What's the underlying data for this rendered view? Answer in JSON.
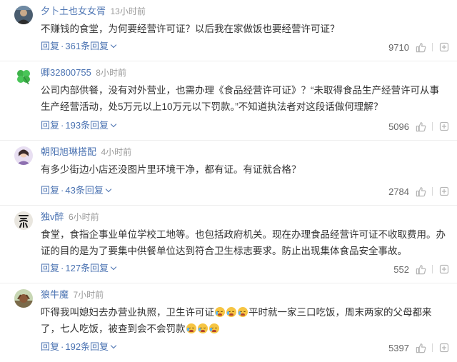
{
  "comments": [
    {
      "username": "夕卜土也女女胥",
      "time": "13小时前",
      "text": "不赚钱的食堂，为何要经营许可证？以后我在家做饭也要经营许可证？",
      "reply_label": "回复",
      "replies_label": "361条回复",
      "likes": "9710",
      "avatar_icon": "avatar-photo-icon",
      "avatar_color": "#5a4a3d"
    },
    {
      "username": "卿32800755",
      "time": "8小时前",
      "text": "公司内部供餐，没有对外营业，也需办理《食品经营许可证》？“未取得食品生产经营许可从事生产经营活动，处5万元以上10万元以下罚款。”不知道执法者对这段话做何理解？",
      "reply_label": "回复",
      "replies_label": "193条回复",
      "likes": "5096",
      "avatar_icon": "clover-icon",
      "avatar_color": "#3db249"
    },
    {
      "username": "朝阳旭琳搭配",
      "time": "4小时前",
      "text": "有多少街边小店还没图片里环境干净，都有证。有证就合格？",
      "reply_label": "回复",
      "replies_label": "43条回复",
      "likes": "2784",
      "avatar_icon": "avatar-photo-icon",
      "avatar_color": "#8d6fb0"
    },
    {
      "username": "独v醉",
      "time": "6小时前",
      "text": "食堂，食指企事业单位学校工地等。也包括政府机关。现在办理食品经营许可证不收取费用。办证的目的是为了要集中供餐单位达到符合卫生标志要求。防止出现集体食品安全事故。",
      "reply_label": "回复",
      "replies_label": "127条回复",
      "likes": "552",
      "avatar_icon": "calligraphy-avatar-icon",
      "avatar_color": "#555555"
    },
    {
      "username": "狼牛魔",
      "time": "7小时前",
      "text_parts": [
        "吓得我叫媳妇去办营业执照，卫生许可证",
        "平时就一家三口吃饭，周末两家的父母都来了，七人吃饭，被查到会不会罚款"
      ],
      "reply_label": "回复",
      "replies_label": "192条回复",
      "likes": "5397",
      "avatar_icon": "avatar-photo-icon",
      "avatar_color": "#7a6a4a"
    }
  ],
  "icons": {
    "thumb": "thumbs-up-icon",
    "more": "more-icon",
    "emoji": "crying-laughing-emoji-icon"
  },
  "colors": {
    "link": "#4b73b2",
    "text": "#333333",
    "meta": "#9a9a9a"
  }
}
